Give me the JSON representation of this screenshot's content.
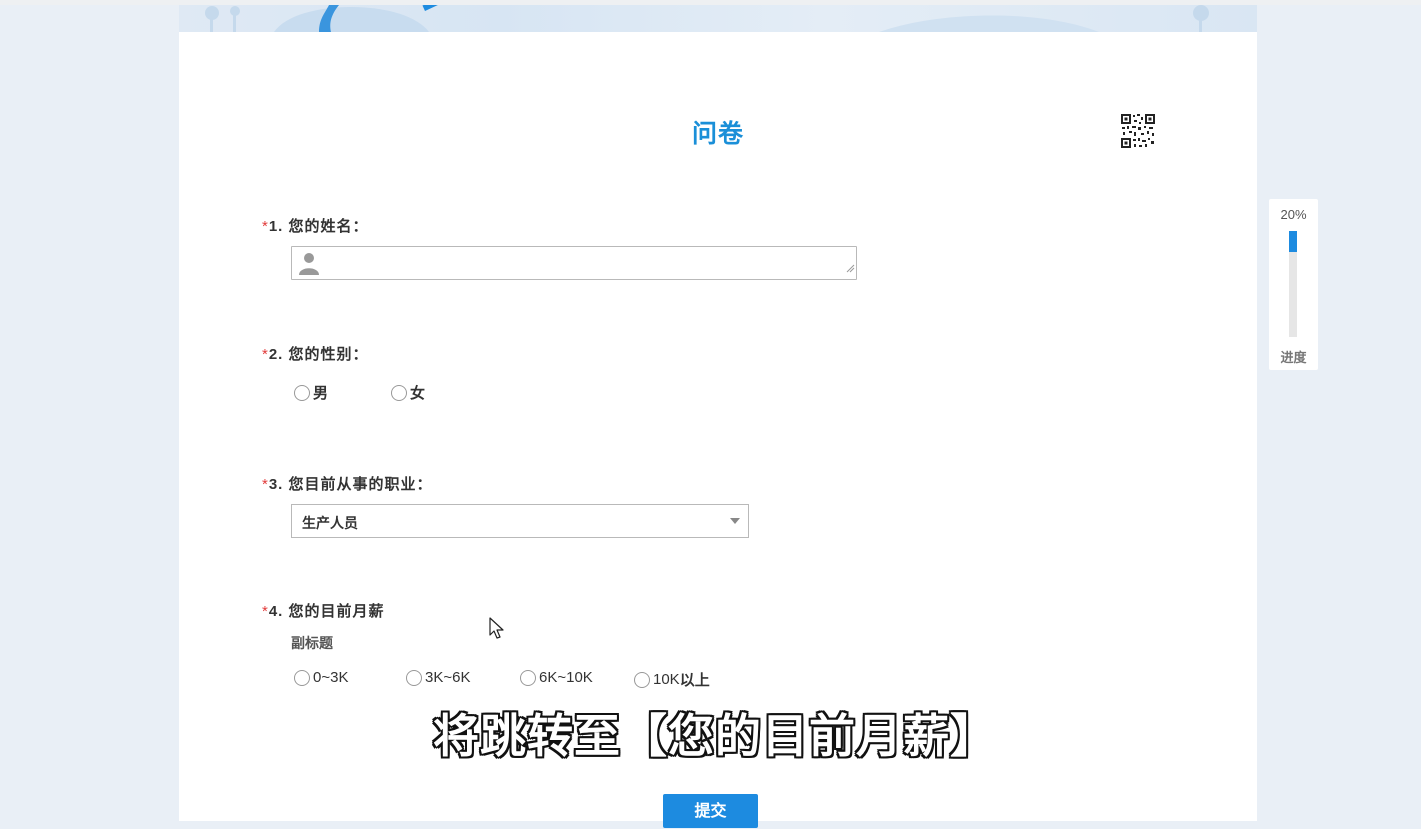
{
  "survey": {
    "title": "问卷",
    "required_mark": "*"
  },
  "questions": [
    {
      "number": "1.",
      "title": "您的姓名："
    },
    {
      "number": "2.",
      "title": "您的性别：",
      "options": [
        "男",
        "女"
      ]
    },
    {
      "number": "3.",
      "title": "您目前从事的职业：",
      "selected": "生产人员"
    },
    {
      "number": "4.",
      "title": "您的目前月薪",
      "subtitle": "副标题",
      "options": [
        "0~3K",
        "3K~6K",
        "6K~10K",
        "10K",
        "以上"
      ]
    }
  ],
  "overlay": {
    "caption": "将跳转至【您的目前月薪】"
  },
  "submit": {
    "label": "提交"
  },
  "progress": {
    "percent_text": "20%",
    "value": 0.2,
    "label": "进度"
  },
  "colors": {
    "accent": "#1d8be0",
    "title": "#1a8fd8",
    "required": "#e23b3b"
  },
  "icons": [
    "qr-code-icon",
    "person-icon",
    "chevron-down-icon",
    "mouse-cursor-icon"
  ]
}
